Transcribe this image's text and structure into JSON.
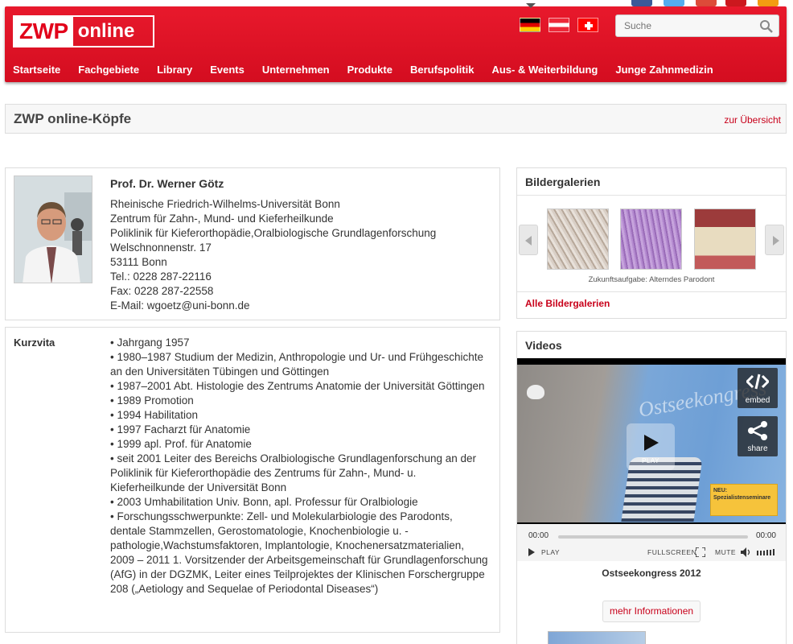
{
  "header": {
    "logo_left": "ZWP",
    "logo_right": "online",
    "search_placeholder": "Suche",
    "nav": [
      "Startseite",
      "Fachgebiete",
      "Library",
      "Events",
      "Unternehmen",
      "Produkte",
      "Berufspolitik",
      "Aus- & Weiterbildung",
      "Junge Zahnmedizin"
    ],
    "brand_color": "#e2001a"
  },
  "titlebar": {
    "title": "ZWP online-Köpfe",
    "overview_link": "zur Übersicht"
  },
  "profile": {
    "name": "Prof. Dr. Werner Götz",
    "address_lines": [
      "Rheinische Friedrich-Wilhelms-Universität Bonn",
      "Zentrum für Zahn-, Mund- und Kieferheilkunde",
      "Poliklinik für Kieferorthopädie,Oralbiologische Grundlagenforschung",
      "Welschnonnenstr. 17",
      "53111 Bonn",
      "Tel.: 0228 287-22116",
      "Fax: 0228 287-22558",
      "E-Mail: wgoetz@uni-bonn.de"
    ]
  },
  "kurzvita": {
    "label": "Kurzvita",
    "text": "• Jahrgang 1957\n• 1980–1987 Studium der Medizin, Anthropologie und Ur- und Frühgeschichte an den Universitäten Tübingen und Göttingen\n• 1987–2001 Abt. Histologie des Zentrums Anatomie der Universität Göttingen\n• 1989 Promotion\n• 1994 Habilitation\n• 1997 Facharzt für Anatomie\n• 1999 apl. Prof. für Anatomie\n• seit 2001 Leiter des Bereichs Oralbiologische Grundlagenforschung an der Poliklinik für Kieferorthopädie des Zentrums für Zahn-, Mund- u. Kieferheilkunde der Universität Bonn\n• 2003 Umhabilitation Univ. Bonn, apl. Professur für Oralbiologie\n• Forschungsschwerpunkte: Zell- und Molekularbiologie des Parodonts, dentale Stammzellen, Gerostomatologie, Knochenbiologie u. -pathologie,Wachstumsfaktoren, Implantologie, Knochenersatzmaterialien, 2009 – 2011 1. Vorsitzender der Arbeitsgemeinschaft für Grundlagenforschung (AfG) in der DGZMK, Leiter eines Teilprojektes der Klinischen Forschergruppe 208 („Aetiology and Sequelae of Periodontal Diseases“)"
  },
  "gallery": {
    "title": "Bildergalerien",
    "caption": "Zukunftsaufgabe: Alterndes Parodont",
    "all_link": "Alle Bildergalerien"
  },
  "videos": {
    "title": "Videos",
    "embed_label": "embed",
    "share_label": "share",
    "play_label": "PLAY",
    "time_start": "00:00",
    "time_end": "00:00",
    "ctl_play": "PLAY",
    "ctl_fullscreen": "FULLSCREEN",
    "ctl_mute": "MUTE",
    "video_title": "Ostseekongress 2012",
    "more_button": "mehr Informationen",
    "frame_watermark": "Ostseekongress",
    "frame_badge": "NEU: Spezialistenseminare"
  }
}
